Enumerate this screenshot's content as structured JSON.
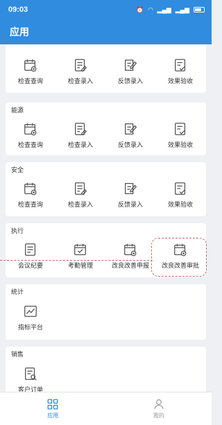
{
  "status_bar": {
    "time": "09:03",
    "icons": [
      "alarm-icon",
      "wifi-icon",
      "signal-icon",
      "signal-icon",
      "battery-icon"
    ]
  },
  "app_bar": {
    "title": "应用"
  },
  "sections": [
    {
      "title": "",
      "items": [
        {
          "label": "检查查询",
          "icon": "calendar-grid-icon"
        },
        {
          "label": "检查录入",
          "icon": "document-edit-icon"
        },
        {
          "label": "反馈录入",
          "icon": "edit-note-icon"
        },
        {
          "label": "效果验收",
          "icon": "check-document-icon"
        }
      ]
    },
    {
      "title": "能源",
      "items": [
        {
          "label": "检查查询",
          "icon": "calendar-grid-icon"
        },
        {
          "label": "检查录入",
          "icon": "document-edit-icon"
        },
        {
          "label": "反馈录入",
          "icon": "edit-note-icon"
        },
        {
          "label": "效果验收",
          "icon": "check-document-icon"
        }
      ]
    },
    {
      "title": "安全",
      "items": [
        {
          "label": "检查查询",
          "icon": "calendar-grid-icon"
        },
        {
          "label": "检查录入",
          "icon": "document-edit-icon"
        },
        {
          "label": "反馈录入",
          "icon": "edit-note-icon"
        },
        {
          "label": "效果验收",
          "icon": "check-document-icon"
        }
      ]
    },
    {
      "title": "执行",
      "items": [
        {
          "label": "会议纪要",
          "icon": "document-lines-icon"
        },
        {
          "label": "考勤管理",
          "icon": "calendar-check-icon"
        },
        {
          "label": "改良改善申报",
          "icon": "calendar-grid-icon"
        },
        {
          "label": "改良改善审批",
          "icon": "calendar-grid-icon"
        }
      ]
    },
    {
      "title": "统计",
      "items": [
        {
          "label": "指标平台",
          "icon": "line-chart-icon"
        }
      ]
    },
    {
      "title": "销售",
      "items": [
        {
          "label": "客户订单",
          "icon": "document-search-icon"
        }
      ]
    }
  ],
  "tab_bar": {
    "tabs": [
      {
        "label": "应用",
        "icon": "grid-apps-icon",
        "active": true
      },
      {
        "label": "我的",
        "icon": "person-icon",
        "active": false
      }
    ]
  },
  "colors": {
    "primary": "#2f8cdf",
    "highlight": "#c76a6a",
    "background": "#eef0f3"
  }
}
